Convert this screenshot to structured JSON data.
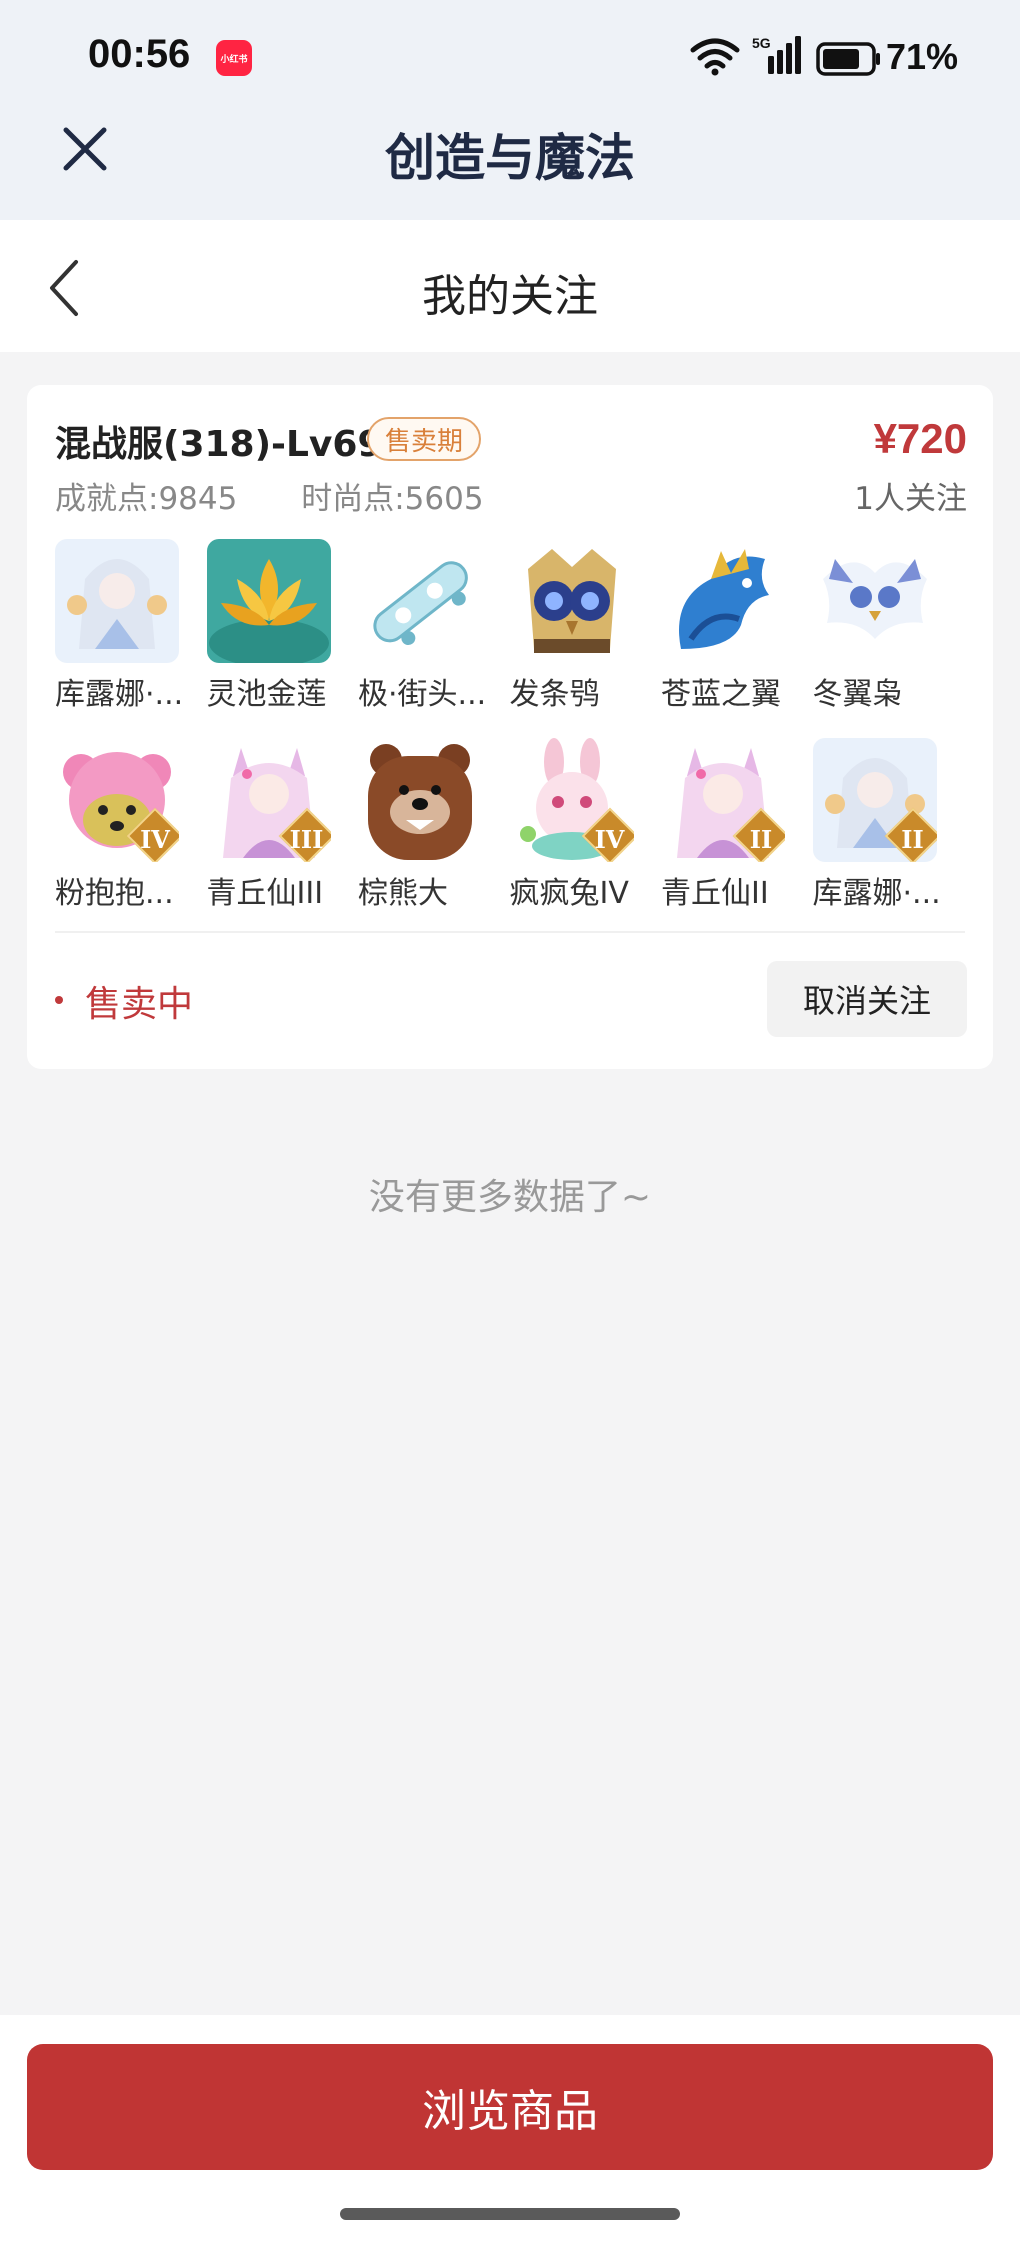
{
  "status_bar": {
    "time": "00:56",
    "app_badge": "小红书",
    "battery": "71%"
  },
  "app": {
    "title": "创造与魔法"
  },
  "page": {
    "title": "我的关注"
  },
  "listing": {
    "server": "混战服(318)-Lv69",
    "badge": "售卖期",
    "price": "¥720",
    "achievement": "成就点:9845",
    "fashion": "时尚点:5605",
    "followers": "1人关注",
    "items": [
      {
        "name": "库露娜·...",
        "icon": "ice-maiden-icon",
        "rank": ""
      },
      {
        "name": "灵池金莲",
        "icon": "golden-lotus-icon",
        "rank": ""
      },
      {
        "name": "极·街头...",
        "icon": "skateboard-icon",
        "rank": ""
      },
      {
        "name": "发条鸮",
        "icon": "clockwork-owl-icon",
        "rank": ""
      },
      {
        "name": "苍蓝之翼",
        "icon": "azure-wing-dragon-icon",
        "rank": ""
      },
      {
        "name": "冬翼枭",
        "icon": "winter-owl-icon",
        "rank": ""
      },
      {
        "name": "粉抱抱...",
        "icon": "pink-bear-icon",
        "rank": "IV"
      },
      {
        "name": "青丘仙III",
        "icon": "fox-fairy-icon",
        "rank": "III"
      },
      {
        "name": "棕熊大",
        "icon": "brown-bear-icon",
        "rank": ""
      },
      {
        "name": "疯疯兔IV",
        "icon": "crazy-rabbit-icon",
        "rank": "IV"
      },
      {
        "name": "青丘仙II",
        "icon": "fox-fairy-icon",
        "rank": "II"
      },
      {
        "name": "库露娜·...",
        "icon": "ice-maiden-icon",
        "rank": "II"
      }
    ],
    "status": "售卖中",
    "unfollow_label": "取消关注"
  },
  "footer_note": "没有更多数据了~",
  "bottom": {
    "browse_label": "浏览商品"
  },
  "colors": {
    "accent": "#c03534",
    "badge": "#d9803a",
    "header_bg": "#eef2f7"
  }
}
